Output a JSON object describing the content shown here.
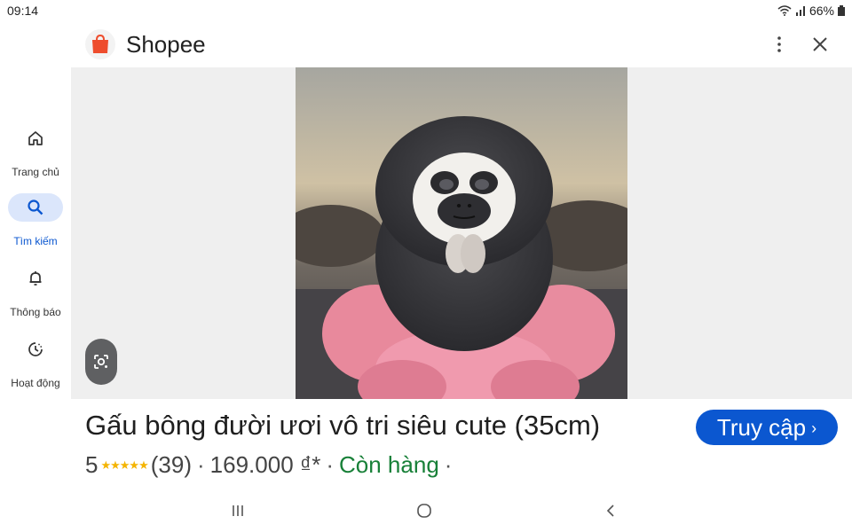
{
  "status": {
    "time": "09:14",
    "battery": "66%"
  },
  "header": {
    "title": "Shopee",
    "logo_letter": "S"
  },
  "sidebar": {
    "items": [
      {
        "label": "Trang chủ",
        "icon": "home-icon"
      },
      {
        "label": "Tìm kiếm",
        "icon": "search-icon",
        "active": true
      },
      {
        "label": "Thông báo",
        "icon": "bell-icon"
      },
      {
        "label": "Hoạt động",
        "icon": "activity-icon"
      }
    ]
  },
  "product": {
    "title": "Gấu bông đười ươi vô tri siêu cute (35cm)",
    "rating": "5",
    "stars": "★★★★★",
    "reviews": "(39)",
    "price": "169.000 ₫*",
    "availability": "Còn hàng",
    "sep": "·",
    "image_icon": "plush-orangutan-photo"
  },
  "actions": {
    "visit_label": "Truy cập"
  },
  "colors": {
    "accent": "#0b57d0",
    "stock": "#188038",
    "shopee": "#ee4d2d",
    "stars": "#f4b400"
  }
}
